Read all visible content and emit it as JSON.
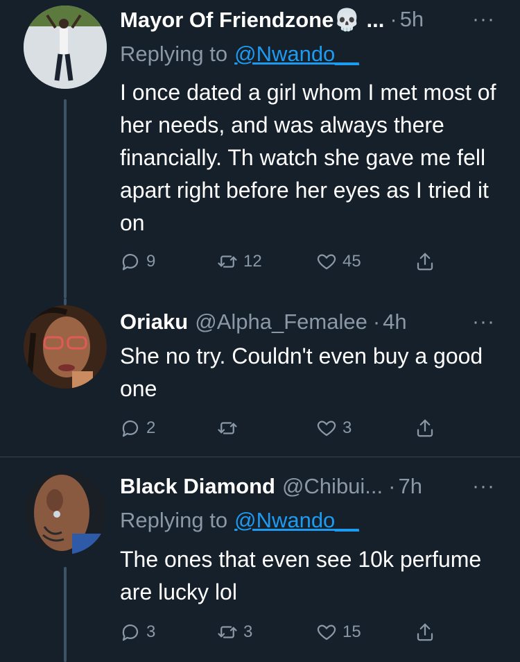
{
  "tweets": [
    {
      "name": "Mayor Of Friendzone💀 ...",
      "handle": "",
      "time": "5h",
      "replying_label": "Replying to",
      "replying_to": "@Nwando__",
      "body": "I once dated a girl whom I met most of her needs, and was always there financially. Th watch she gave me fell apart right before her eyes as I tried it on",
      "replies": "9",
      "retweets": "12",
      "likes": "45"
    },
    {
      "name": "Oriaku",
      "handle": "@Alpha_Femalee",
      "time": "4h",
      "body": "She no try. Couldn't even buy a good one",
      "replies": "2",
      "retweets": "",
      "likes": "3"
    },
    {
      "name": "Black Diamond",
      "handle": "@Chibui...",
      "time": "7h",
      "replying_label": "Replying to",
      "replying_to": "@Nwando__",
      "body": "The ones that even see 10k perfume are lucky lol",
      "replies": "3",
      "retweets": "3",
      "likes": "15"
    }
  ],
  "ui": {
    "separator": "·",
    "more": "···"
  },
  "colors": {
    "background": "#15202b",
    "secondary_text": "#8b98a5",
    "link": "#1d9bf0",
    "divider": "#38444d"
  },
  "icons": [
    "reply-icon",
    "retweet-icon",
    "like-icon",
    "share-icon",
    "more-icon"
  ]
}
